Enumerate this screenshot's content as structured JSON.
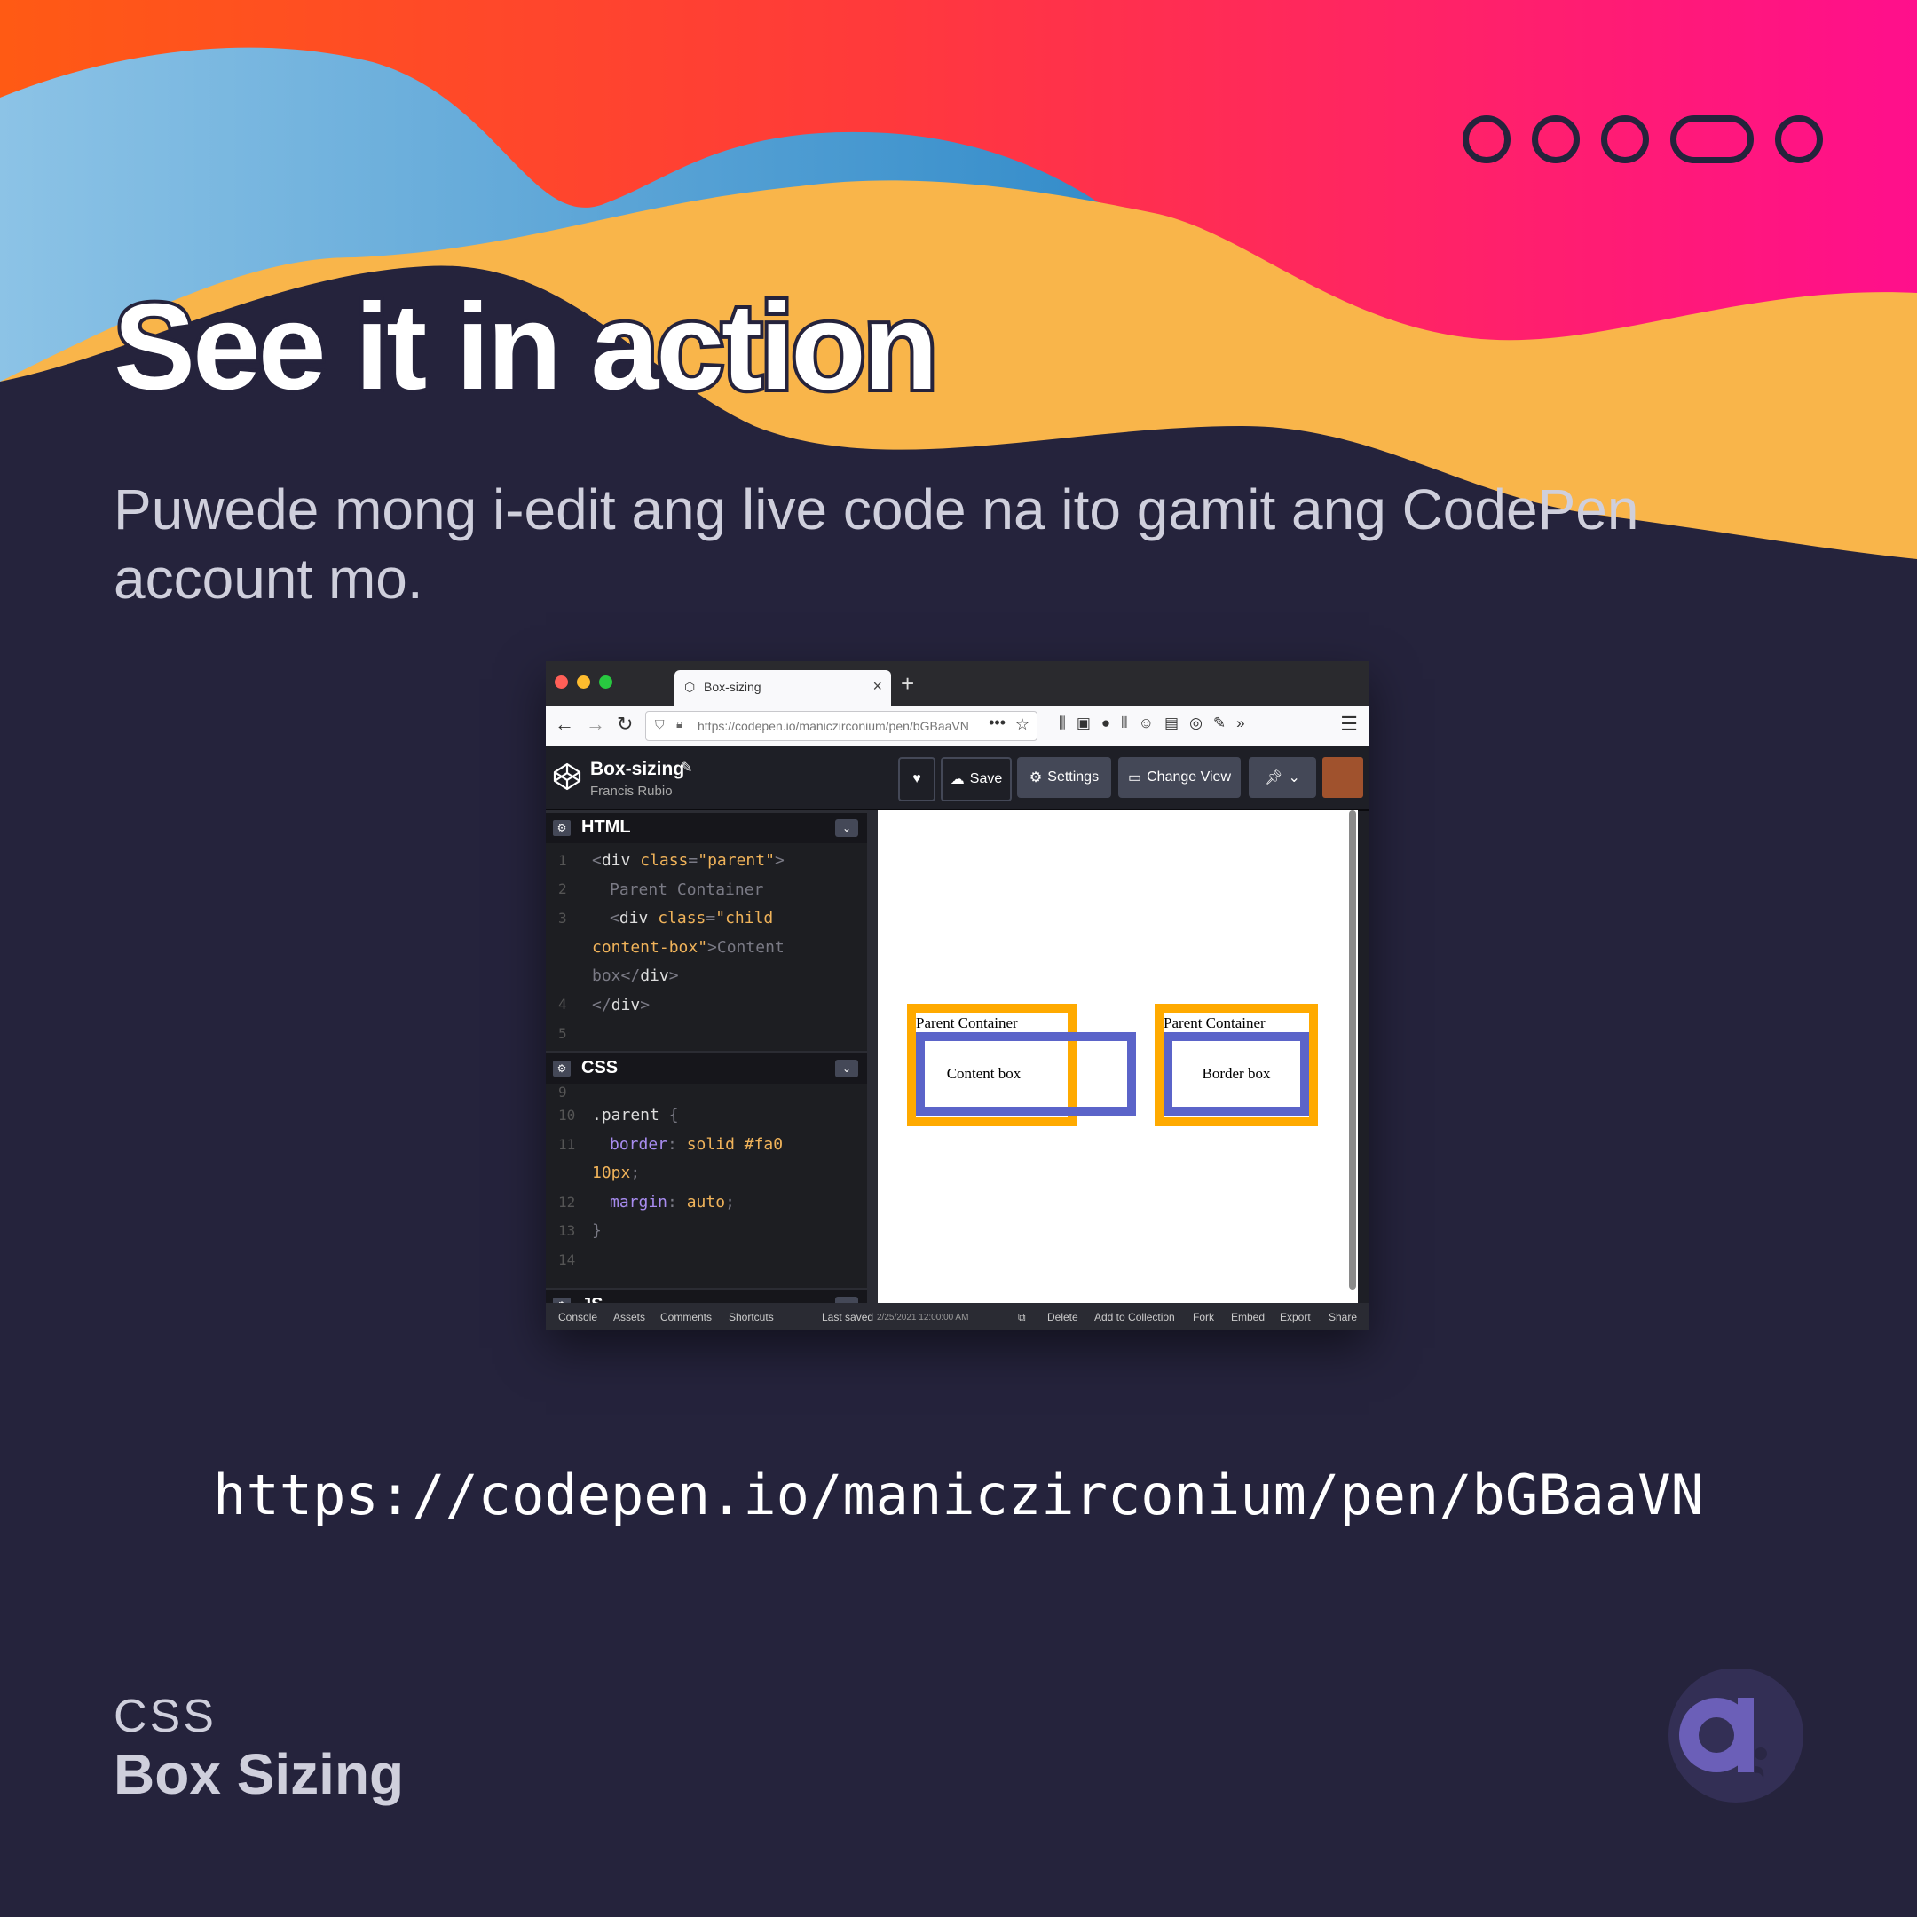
{
  "slide": {
    "headline": "See it in action",
    "subtext": "Puwede mong i-edit ang live code na ito gamit ang CodePen account mo.",
    "url": "https://codepen.io/maniczirconium/pen/bGBaaVN",
    "footer": {
      "topic": "CSS",
      "title": "Box Sizing"
    },
    "colors": {
      "background": "#25233c",
      "accent_orange": "#f9b54a",
      "accent_blue": "#4a9fd0",
      "accent_pink": "#ff1a75"
    }
  },
  "browser": {
    "tab_title": "Box-sizing",
    "address": "https://codepen.io/maniczirconium/pen/bGBaaVN"
  },
  "codepen": {
    "pen_title": "Box-sizing",
    "author": "Francis Rubio",
    "buttons": {
      "save": "Save",
      "settings": "Settings",
      "change_view": "Change View"
    },
    "html_editor": {
      "label": "HTML",
      "line_numbers": [
        "1",
        "2",
        "3",
        "4",
        "5"
      ]
    },
    "css_editor": {
      "label": "CSS",
      "line_numbers": [
        "9",
        "10",
        "11",
        "12",
        "13",
        "14"
      ]
    },
    "js_editor": {
      "label": "JS"
    },
    "preview": {
      "parent_label_1": "Parent Container",
      "child_label_1": "Content box",
      "parent_label_2": "Parent Container",
      "child_label_2": "Border box"
    },
    "statusbar": {
      "console": "Console",
      "assets": "Assets",
      "comments": "Comments",
      "shortcuts": "Shortcuts",
      "last_saved_label": "Last saved",
      "last_saved_time": "2/25/2021 12:00:00 AM",
      "delete": "Delete",
      "add_to_collection": "Add to Collection",
      "fork": "Fork",
      "embed": "Embed",
      "export": "Export",
      "share": "Share"
    }
  }
}
